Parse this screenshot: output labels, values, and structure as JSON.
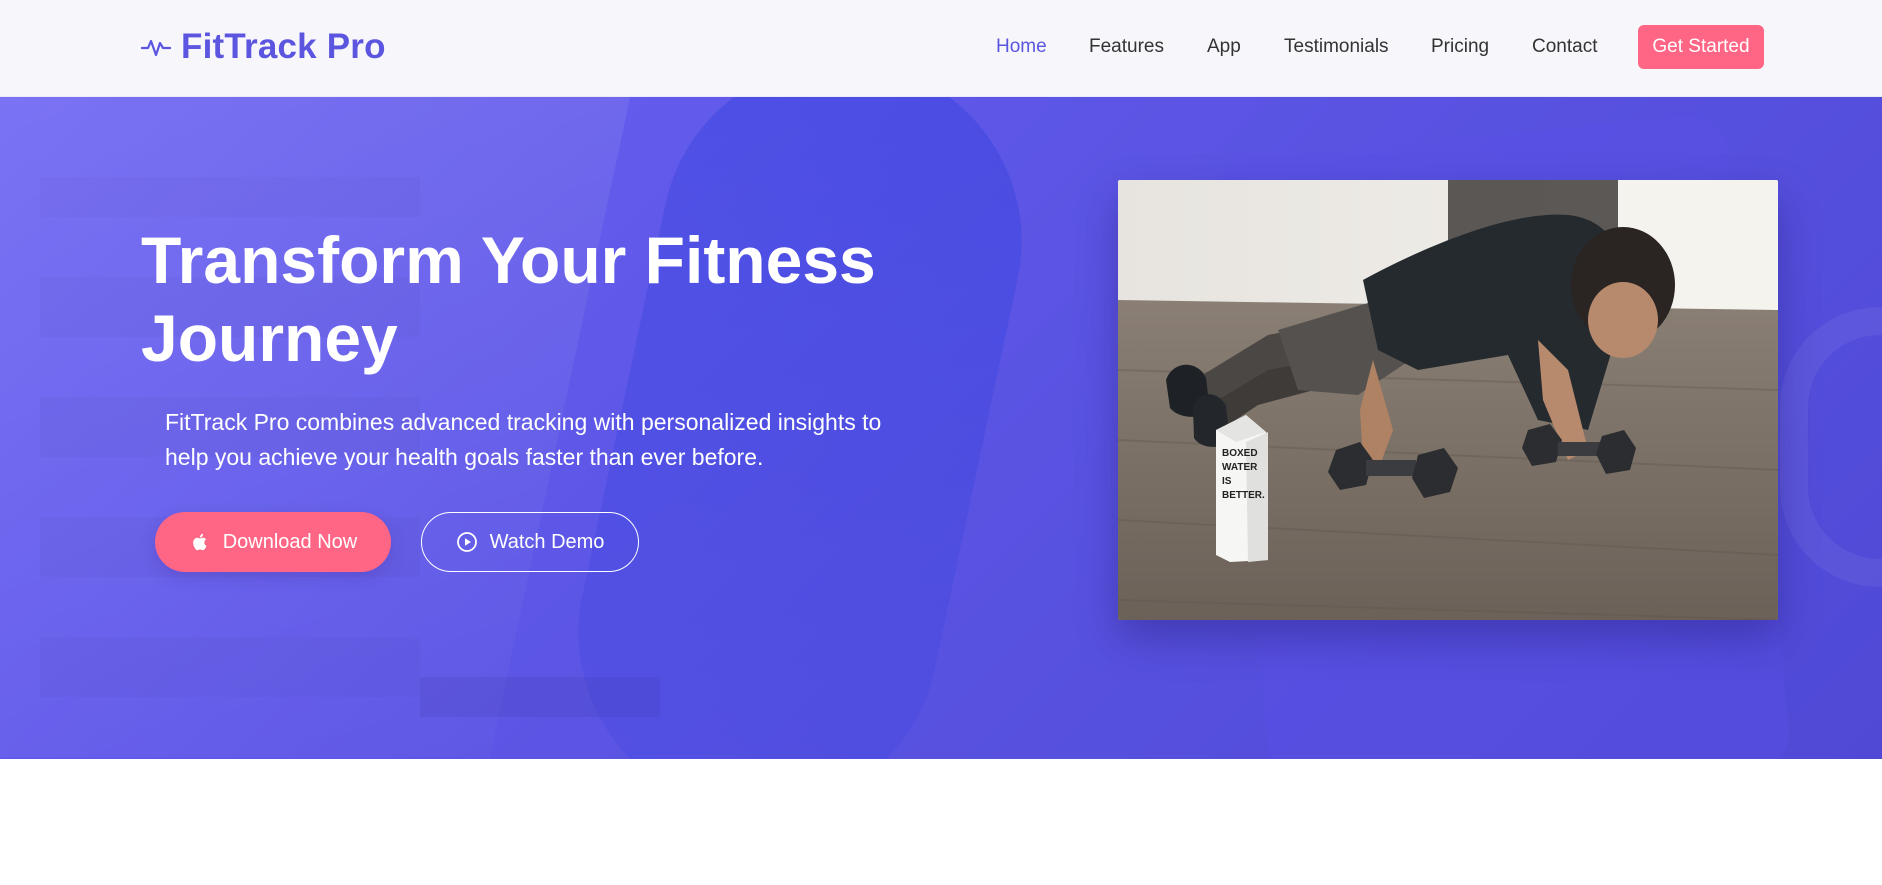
{
  "brand": {
    "name": "FitTrack Pro",
    "icon": "pulse-icon",
    "color": "#5b55e0"
  },
  "nav": {
    "links": [
      "Home",
      "Features",
      "App",
      "Testimonials",
      "Pricing",
      "Contact"
    ],
    "active": "Home",
    "cta_label": "Get Started"
  },
  "hero": {
    "title": "Transform Your Fitness Journey",
    "subtitle": "FitTrack Pro combines advanced tracking with personalized insights to help you achieve your health goals faster than ever before.",
    "primary_button": {
      "label": "Download Now",
      "icon": "apple-icon"
    },
    "secondary_button": {
      "label": "Watch Demo",
      "icon": "play-circle-icon"
    },
    "image": {
      "carton_text": "BOXED WATER IS BETTER."
    }
  },
  "colors": {
    "accent": "#5b55e0",
    "cta": "#ff6584",
    "hero_background": "#5d56e6"
  }
}
